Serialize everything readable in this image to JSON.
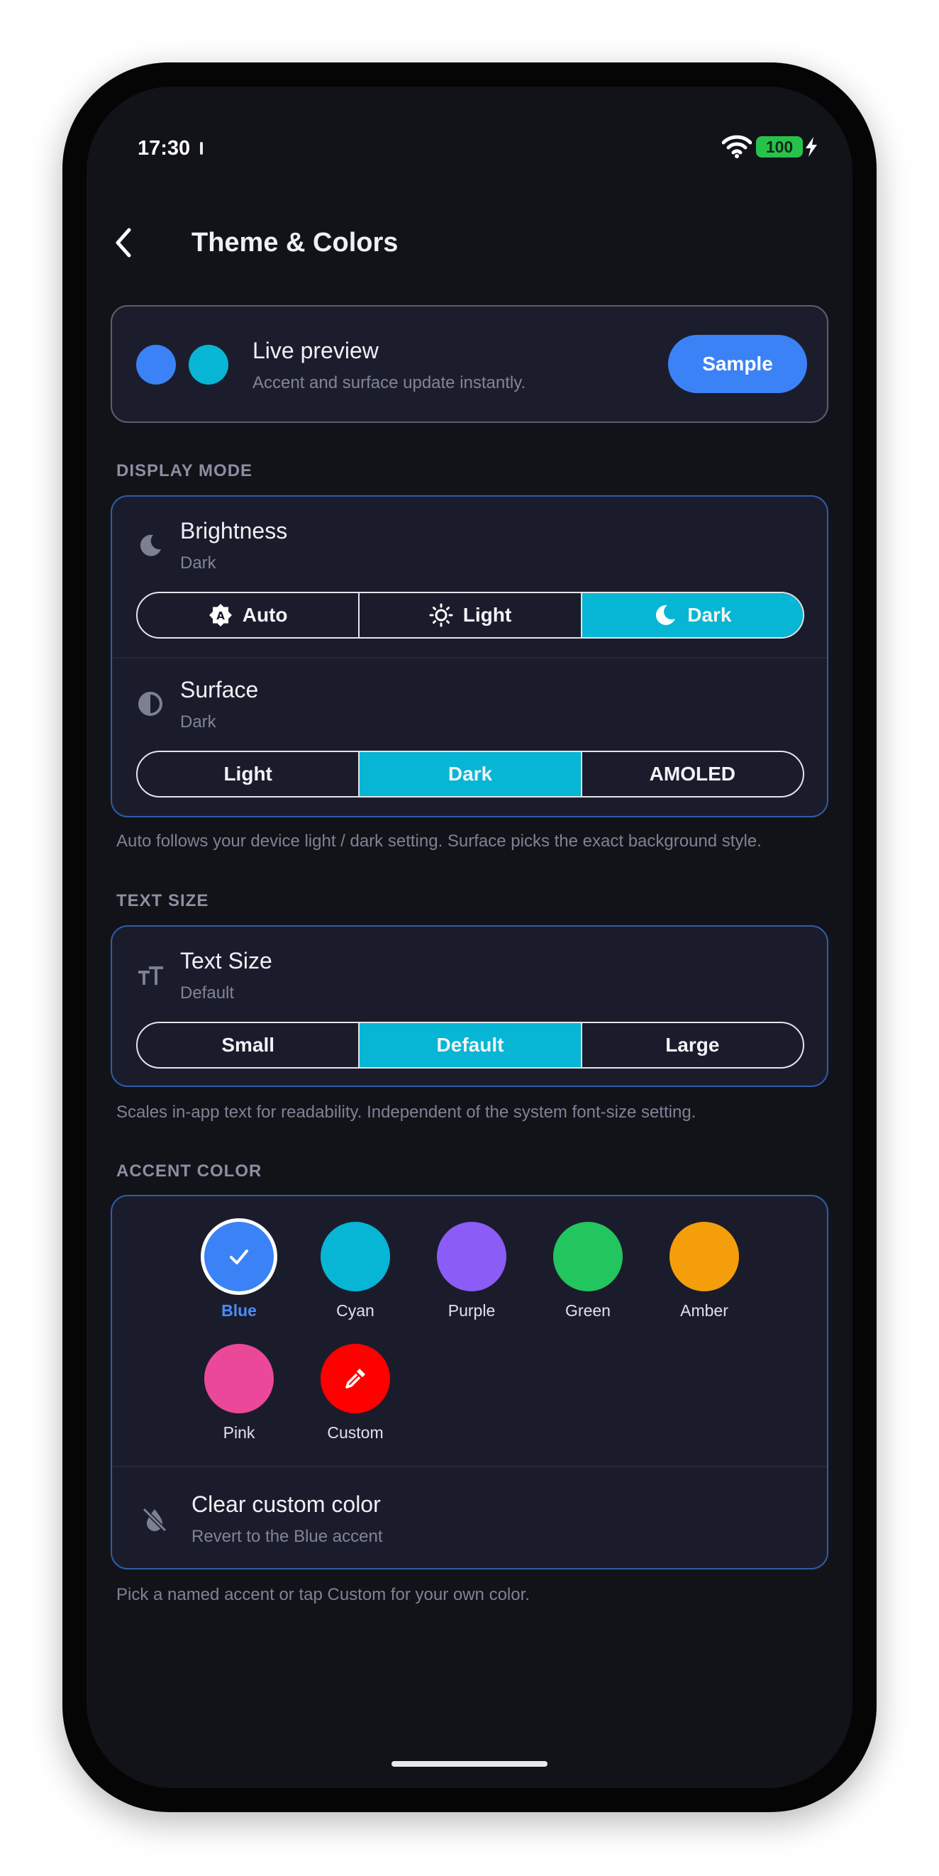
{
  "status_bar": {
    "time": "17:30",
    "battery": "100"
  },
  "header": {
    "title": "Theme & Colors"
  },
  "preview": {
    "title": "Live preview",
    "subtitle": "Accent and surface update instantly.",
    "button": "Sample",
    "dot_colors": [
      "#3b82f6",
      "#06b6d4"
    ]
  },
  "display_mode": {
    "section_label": "DISPLAY MODE",
    "brightness": {
      "title": "Brightness",
      "value": "Dark",
      "options": [
        "Auto",
        "Light",
        "Dark"
      ],
      "selected": "Dark"
    },
    "surface": {
      "title": "Surface",
      "value": "Dark",
      "options": [
        "Light",
        "Dark",
        "AMOLED"
      ],
      "selected": "Dark"
    },
    "helper": "Auto follows your device light / dark setting. Surface picks the exact background style."
  },
  "text_size": {
    "section_label": "TEXT SIZE",
    "title": "Text Size",
    "value": "Default",
    "options": [
      "Small",
      "Default",
      "Large"
    ],
    "selected": "Default",
    "helper": "Scales in-app text for readability. Independent of the system font-size setting."
  },
  "accent": {
    "section_label": "ACCENT COLOR",
    "colors": [
      {
        "name": "Blue",
        "color": "#3b82f6",
        "selected": true
      },
      {
        "name": "Cyan",
        "color": "#06b6d4"
      },
      {
        "name": "Purple",
        "color": "#8b5cf6"
      },
      {
        "name": "Green",
        "color": "#22c55e"
      },
      {
        "name": "Amber",
        "color": "#f59e0b"
      },
      {
        "name": "Pink",
        "color": "#ec4899"
      },
      {
        "name": "Custom",
        "color": "#ff0000"
      }
    ],
    "clear": {
      "title": "Clear custom color",
      "subtitle": "Revert to the Blue accent"
    },
    "helper": "Pick a named accent or tap Custom for your own color."
  },
  "colors": {
    "accent": "#3b82f6",
    "segment_active": "#06b6d4",
    "card": "#1b1c2b",
    "background": "#121319"
  }
}
